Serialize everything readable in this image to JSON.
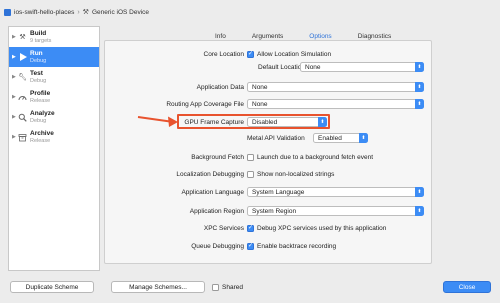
{
  "breadcrumb": {
    "project": "ios-swift-hello-places",
    "destination": "Generic iOS Device"
  },
  "sidebar": {
    "items": [
      {
        "title": "Build",
        "subtitle": "9 targets",
        "icon": "hammer-icon"
      },
      {
        "title": "Run",
        "subtitle": "Debug",
        "icon": "play-icon"
      },
      {
        "title": "Test",
        "subtitle": "Debug",
        "icon": "wrench-icon"
      },
      {
        "title": "Profile",
        "subtitle": "Release",
        "icon": "gauge-icon"
      },
      {
        "title": "Analyze",
        "subtitle": "Debug",
        "icon": "magnifier-icon"
      },
      {
        "title": "Archive",
        "subtitle": "Release",
        "icon": "archive-icon"
      }
    ]
  },
  "tabs": [
    "Info",
    "Arguments",
    "Options",
    "Diagnostics"
  ],
  "options": {
    "core_location_label": "Core Location",
    "allow_location_simulation": "Allow Location Simulation",
    "default_location_label": "Default Location",
    "default_location_value": "None",
    "application_data_label": "Application Data",
    "application_data_value": "None",
    "routing_label": "Routing App Coverage File",
    "routing_value": "None",
    "gpu_label": "GPU Frame Capture",
    "gpu_value": "Disabled",
    "metal_label": "Metal API Validation",
    "metal_value": "Enabled",
    "background_fetch_label": "Background Fetch",
    "background_fetch_option": "Launch due to a background fetch event",
    "localization_label": "Localization Debugging",
    "localization_option": "Show non-localized strings",
    "app_language_label": "Application Language",
    "app_language_value": "System Language",
    "app_region_label": "Application Region",
    "app_region_value": "System Region",
    "xpc_label": "XPC Services",
    "xpc_option": "Debug XPC services used by this application",
    "queue_label": "Queue Debugging",
    "queue_option": "Enable backtrace recording"
  },
  "buttons": {
    "duplicate": "Duplicate Scheme",
    "manage": "Manage Schemes...",
    "shared": "Shared",
    "close": "Close"
  },
  "colors": {
    "accent": "#3c8cf5",
    "annotation": "#e8532e"
  }
}
